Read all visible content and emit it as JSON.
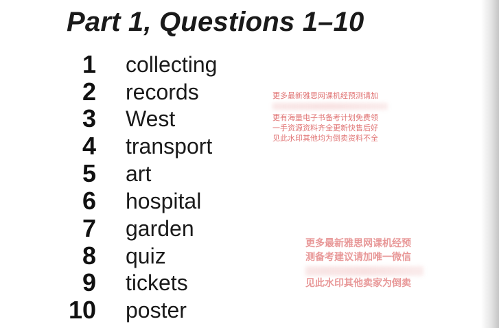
{
  "title": "Part 1, Questions 1–10",
  "answers": [
    {
      "number": "1",
      "word": "collecting"
    },
    {
      "number": "2",
      "word": "records"
    },
    {
      "number": "3",
      "word": "West"
    },
    {
      "number": "4",
      "word": "transport"
    },
    {
      "number": "5",
      "word": "art"
    },
    {
      "number": "6",
      "word": "hospital"
    },
    {
      "number": "7",
      "word": "garden"
    },
    {
      "number": "8",
      "word": "quiz"
    },
    {
      "number": "9",
      "word": "tickets"
    },
    {
      "number": "10",
      "word": "poster"
    }
  ],
  "watermarks": {
    "top": {
      "line1": "更多最新雅思网课机经预测请加",
      "line2": "更有海量电子书备考计划免费领",
      "line3": "一手资源资料齐全更新快售后好",
      "line4": "见此水印其他均为倒卖资料不全"
    },
    "bottom": {
      "line1": "更多最新雅思网课机经预",
      "line2": "测备考建议请加唯一微信",
      "line3": "见此水印其他卖家为倒卖"
    },
    "color": "#d64545"
  }
}
